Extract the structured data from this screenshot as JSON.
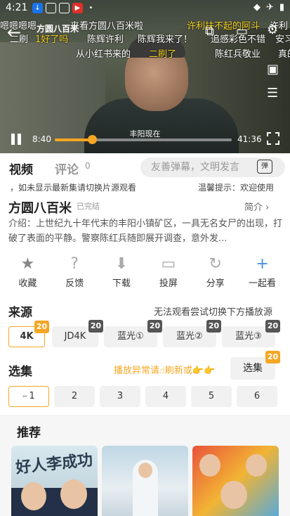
{
  "status": {
    "time": "4:21"
  },
  "player": {
    "title": "方圆八百米",
    "current_time": "8:40",
    "duration": "41:36",
    "progress_fraction": 0.21,
    "subtitle": "丰阳现在",
    "danmaku": [
      {
        "text": "嗯嗯嗯嗯",
        "color": "white"
      },
      {
        "text": "来看方圆八百米啦",
        "color": "white"
      },
      {
        "text": "许利扶不起的阿斗",
        "color": "yellow"
      },
      {
        "text": "许利",
        "color": "white"
      },
      {
        "text": "二刷",
        "color": "white"
      },
      {
        "text": "1好了吗",
        "color": "yellow"
      },
      {
        "text": "陈辉许利",
        "color": "white"
      },
      {
        "text": "陈辉我来了！",
        "color": "white"
      },
      {
        "text": "追感彩色不错",
        "color": "white"
      },
      {
        "text": "安习",
        "color": "white"
      },
      {
        "text": "从小红书来的",
        "color": "white"
      },
      {
        "text": "二刷了",
        "color": "yellow"
      },
      {
        "text": "陈红兵敬业",
        "color": "white"
      },
      {
        "text": "真的",
        "color": "white"
      }
    ]
  },
  "tabs": {
    "video": "视频",
    "comments": "评论",
    "comment_count": "0",
    "danmaku_placeholder": "友善弹幕，文明发言",
    "danmaku_btn": "弹"
  },
  "marquee": {
    "left": "，如未显示最新集请切换片源观看",
    "right": "温馨提示：欢迎使用"
  },
  "show": {
    "title": "方圆八百米",
    "status": "已完结",
    "brief": "简介 ›",
    "desc": "介绍：上世纪九十年代末的丰阳小镇矿区，一具无名女尸的出现，打破了表面的平静。警察陈红兵随即展开调查，意外发..."
  },
  "actions": [
    {
      "label": "收藏",
      "icon": "star-icon"
    },
    {
      "label": "反馈",
      "icon": "question-icon"
    },
    {
      "label": "下载",
      "icon": "download-icon"
    },
    {
      "label": "投屏",
      "icon": "tv-icon"
    },
    {
      "label": "分享",
      "icon": "share-icon"
    },
    {
      "label": "一起看",
      "icon": "add-user-icon"
    }
  ],
  "source": {
    "title": "来源",
    "note": "无法观看尝试切换下方播放源",
    "items": [
      {
        "label": "4K",
        "badge": "20"
      },
      {
        "label": "JD4K",
        "badge": "20"
      },
      {
        "label": "蓝光①",
        "badge": "20"
      },
      {
        "label": "蓝光②",
        "badge": "20"
      },
      {
        "label": "蓝光③",
        "badge": "20"
      }
    ]
  },
  "episodes": {
    "title": "选集",
    "note": "播放异常请☝刷新或👉👉",
    "button": "选集",
    "badge": "20",
    "items": [
      "1",
      "2",
      "3",
      "4",
      "5",
      "6"
    ]
  },
  "recommend": {
    "title": "推荐",
    "poster1_title": "好人李成功"
  }
}
